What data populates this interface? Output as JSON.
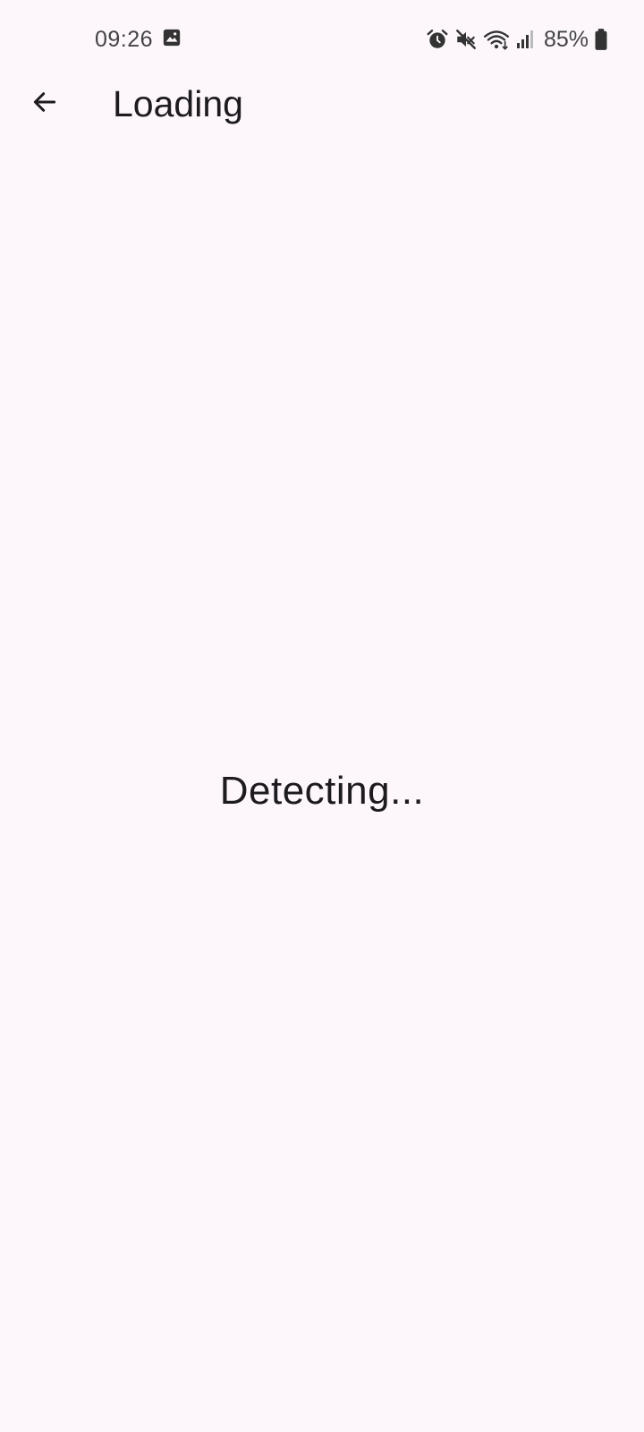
{
  "status_bar": {
    "time": "09:26",
    "battery": "85%",
    "icons": [
      "image-icon",
      "alarm-icon",
      "mute-icon",
      "wifi-icon",
      "signal-icon",
      "battery-icon"
    ]
  },
  "app_bar": {
    "title": "Loading",
    "back_icon": "arrow-left-icon"
  },
  "main": {
    "message": "Detecting..."
  },
  "colors": {
    "background": "#fdf7fc",
    "text": "#1d1b20",
    "status_text": "#444444"
  }
}
